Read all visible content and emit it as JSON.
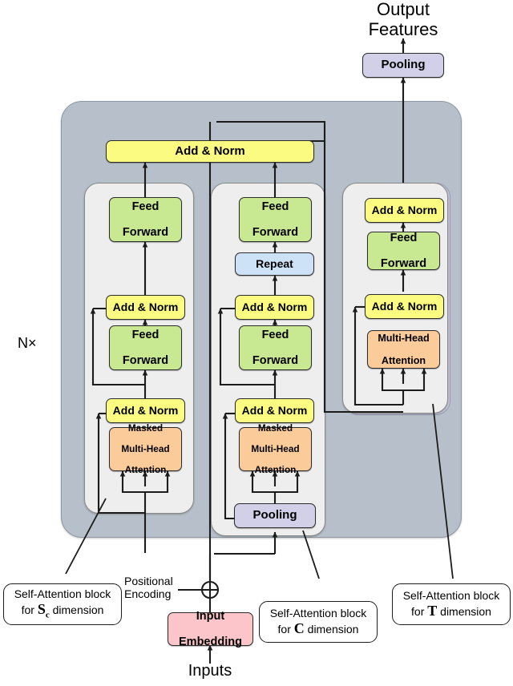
{
  "figure": {
    "kind": "transformer-architecture-diagram",
    "top_label": {
      "line1": "Output",
      "line2": "Features"
    },
    "bottom_label": "Inputs",
    "repeat_label": "N×",
    "positional_encoding": {
      "line1": "Positional",
      "line2": "Encoding"
    },
    "add_symbol": "⊕"
  },
  "colors": {
    "add_norm": "#fbfb81",
    "feed_forward": "#c8e892",
    "attention": "#fbcb9a",
    "repeat": "#cde2f7",
    "pooling": "#d2d0e8",
    "input_embedding": "#fbc5c9",
    "outer_panel": "#b7c0ca",
    "column_panel": "#eeeeee",
    "column_panel_tint": "#c8c8dd",
    "stroke": "#2b2b2b"
  },
  "nodes": {
    "output_pooling": "Pooling",
    "top_add_norm": "Add & Norm",
    "input_embedding": {
      "line1": "Input",
      "line2": "Embedding"
    }
  },
  "columns": [
    {
      "id": "sc",
      "blocks": [
        {
          "name": "feed-forward",
          "line1": "Feed",
          "line2": "Forward"
        },
        {
          "name": "add-norm",
          "line1": "Add & Norm"
        },
        {
          "name": "feed-forward",
          "line1": "Feed",
          "line2": "Forward"
        },
        {
          "name": "add-norm",
          "line1": "Add & Norm"
        },
        {
          "name": "masked-multi-head-attention",
          "line1": "Masked",
          "line2": "Multi-Head",
          "line3": "Attention"
        }
      ]
    },
    {
      "id": "c",
      "blocks": [
        {
          "name": "feed-forward",
          "line1": "Feed",
          "line2": "Forward"
        },
        {
          "name": "repeat",
          "line1": "Repeat"
        },
        {
          "name": "add-norm",
          "line1": "Add & Norm"
        },
        {
          "name": "feed-forward",
          "line1": "Feed",
          "line2": "Forward"
        },
        {
          "name": "add-norm",
          "line1": "Add & Norm"
        },
        {
          "name": "masked-multi-head-attention",
          "line1": "Masked",
          "line2": "Multi-Head",
          "line3": "Attention"
        },
        {
          "name": "pooling",
          "line1": "Pooling"
        }
      ]
    },
    {
      "id": "t",
      "blocks": [
        {
          "name": "add-norm",
          "line1": "Add & Norm"
        },
        {
          "name": "feed-forward",
          "line1": "Feed",
          "line2": "Forward"
        },
        {
          "name": "add-norm",
          "line1": "Add & Norm"
        },
        {
          "name": "multi-head-attention",
          "line1": "Multi-Head",
          "line2": "Attention"
        }
      ]
    }
  ],
  "callouts": [
    {
      "id": "sc",
      "line1": "Self-Attention block",
      "prefix": "for ",
      "symbol": "S",
      "subscript": "c",
      "suffix": " dimension"
    },
    {
      "id": "c",
      "line1": "Self-Attention block",
      "prefix": "for ",
      "symbol": "C",
      "subscript": "",
      "suffix": " dimension"
    },
    {
      "id": "t",
      "line1": "Self-Attention block",
      "prefix": "for ",
      "symbol": "T",
      "subscript": "",
      "suffix": " dimension"
    }
  ]
}
